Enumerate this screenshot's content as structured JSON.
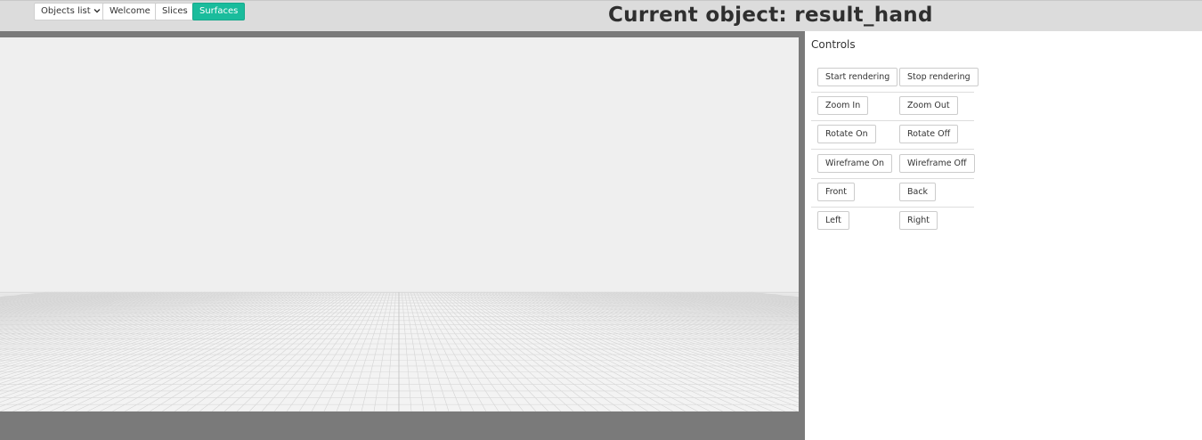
{
  "nav": {
    "objects_select": "Objects list",
    "welcome": "Welcome",
    "slices": "Slices",
    "surfaces": "Surfaces",
    "active_tab": "Surfaces"
  },
  "header": {
    "title": "Current object: result_hand"
  },
  "controls": {
    "title": "Controls",
    "rows": [
      {
        "left": "Start rendering",
        "right": "Stop rendering"
      },
      {
        "left": "Zoom In",
        "right": "Zoom Out"
      },
      {
        "left": "Rotate On",
        "right": "Rotate Off"
      },
      {
        "left": "Wireframe On",
        "right": "Wireframe Off"
      },
      {
        "left": "Front",
        "right": "Back"
      },
      {
        "left": "Left",
        "right": "Right"
      }
    ]
  },
  "colors": {
    "accent": "#1abc9c",
    "topbar": "#dcdcdc",
    "viewport_frame": "#7a7a7a",
    "canvas_bg": "#efefef"
  },
  "icons": {
    "select_chevron": "chevron-down-icon"
  }
}
